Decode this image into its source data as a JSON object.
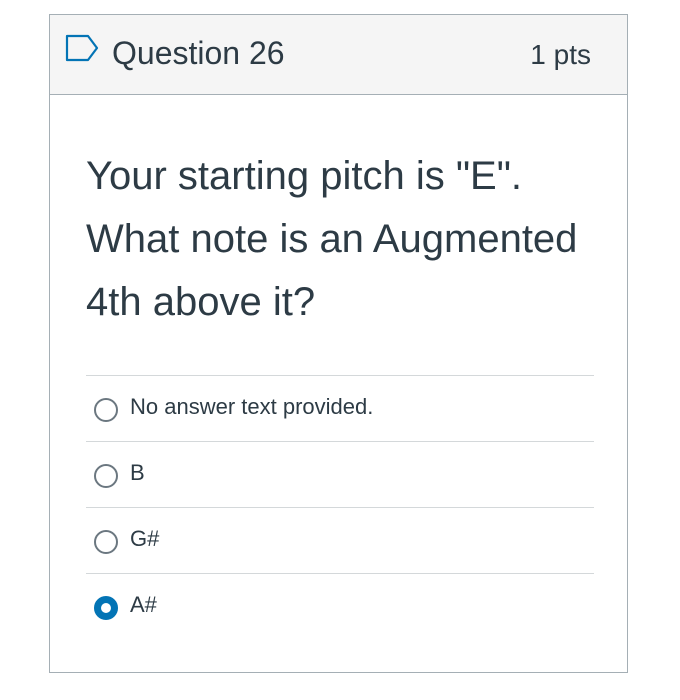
{
  "question": {
    "title": "Question 26",
    "points": "1 pts",
    "text": "Your starting pitch is \"E\". What note is an Augmented 4th above it?",
    "flag_icon": "flag-outline-icon"
  },
  "answers": [
    {
      "label": "No answer text provided.",
      "selected": false
    },
    {
      "label": "B",
      "selected": false
    },
    {
      "label": "G#",
      "selected": false
    },
    {
      "label": "A#",
      "selected": true
    }
  ],
  "colors": {
    "accent": "#0374B5",
    "header_bg": "#f5f5f5",
    "border": "#a5afb5",
    "text": "#2d3b45"
  }
}
